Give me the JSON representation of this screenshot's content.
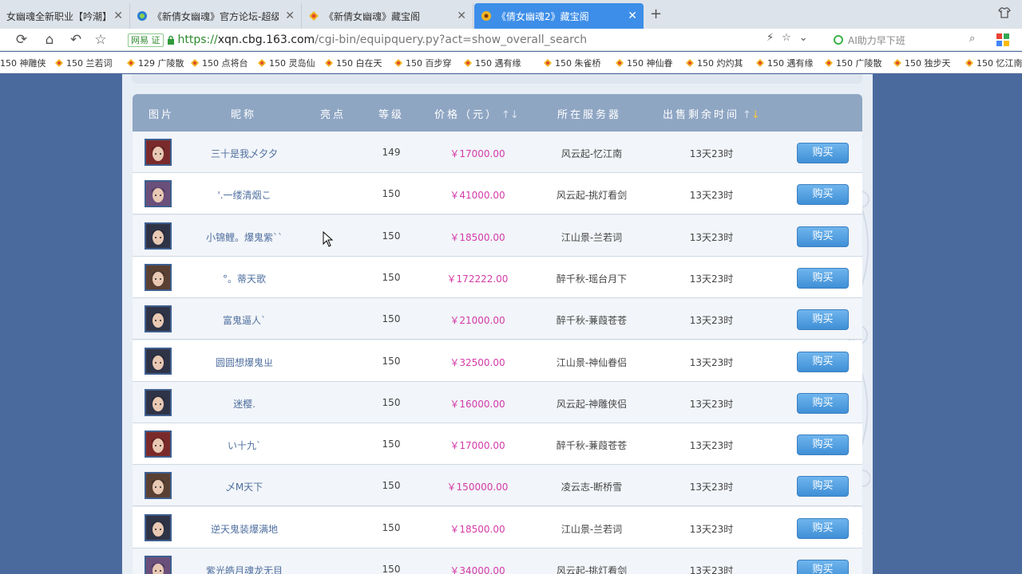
{
  "browser": {
    "tabs": [
      {
        "title": "女幽魂全新职业【吟潮】上",
        "active": false
      },
      {
        "title": "《新倩女幽魂》官方论坛-超级&",
        "active": false
      },
      {
        "title": "《新倩女幽魂》藏宝阁",
        "active": false
      },
      {
        "title": "《倩女幽魂2》藏宝阁",
        "active": true
      }
    ],
    "new_tab": "+",
    "site_badge": "网易",
    "site_badge_tag": "证",
    "url_proto": "https://",
    "url_host": "xqn.cbg.163.com",
    "url_path": "/cgi-bin/equipquery.py?act=show_overall_search",
    "ai_search_placeholder": "AI助力早下班",
    "bookmarks": [
      "150 神雕侠",
      "150 兰若词",
      "129 广陵散",
      "150 点将台",
      "150 灵岛仙",
      "150 白在天",
      "150 百步穿",
      "150 遇有缘",
      "150 朱雀桥",
      "150 神仙眷",
      "150 灼灼其",
      "150 遇有缘",
      "150 广陵散",
      "150 独步天",
      "150 忆江南"
    ]
  },
  "table": {
    "headers": {
      "image": "图片",
      "nickname": "昵称",
      "highlight": "亮点",
      "level": "等级",
      "price": "价格（元）",
      "server": "所在服务器",
      "remaining": "出售剩余时间"
    },
    "sort_up": "↑",
    "sort_down": "↓",
    "buy_label": "购买",
    "rows": [
      {
        "nickname": "三十是我乄夕夕",
        "level": "149",
        "price": "￥17000.00",
        "server": "风云起-忆江南",
        "remaining": "13天23时",
        "avatar_color": "#7a2a2a"
      },
      {
        "nickname": "'.一缕清烟こ",
        "level": "150",
        "price": "￥41000.00",
        "server": "风云起-挑灯看剑",
        "remaining": "13天23时",
        "avatar_color": "#6a4f7a"
      },
      {
        "nickname": "小锦鲤。爆鬼紫``",
        "level": "150",
        "price": "￥18500.00",
        "server": "江山景-兰若词",
        "remaining": "13天23时",
        "avatar_color": "#2f3346"
      },
      {
        "nickname": "°。蒂天歌",
        "level": "150",
        "price": "￥172222.00",
        "server": "醉千秋-瑶台月下",
        "remaining": "13天23时",
        "avatar_color": "#5a4032"
      },
      {
        "nickname": "富鬼逼人`",
        "level": "150",
        "price": "￥21000.00",
        "server": "醉千秋-蒹葭苍苍",
        "remaining": "13天23时",
        "avatar_color": "#2f3346"
      },
      {
        "nickname": "圆圆想爆鬼ㄓ",
        "level": "150",
        "price": "￥32500.00",
        "server": "江山景-神仙眷侣",
        "remaining": "13天23时",
        "avatar_color": "#2f3346"
      },
      {
        "nickname": "迷樱.",
        "level": "150",
        "price": "￥16000.00",
        "server": "风云起-神雕侠侣",
        "remaining": "13天23时",
        "avatar_color": "#2f3346"
      },
      {
        "nickname": "い十九`",
        "level": "150",
        "price": "￥17000.00",
        "server": "醉千秋-蒹葭苍苍",
        "remaining": "13天23时",
        "avatar_color": "#7a2a2a"
      },
      {
        "nickname": "乄M天下",
        "level": "150",
        "price": "￥150000.00",
        "server": "凌云志-断桥雪",
        "remaining": "13天23时",
        "avatar_color": "#5a4032"
      },
      {
        "nickname": "逆天鬼装爆满地",
        "level": "150",
        "price": "￥18500.00",
        "server": "江山景-兰若词",
        "remaining": "13天23时",
        "avatar_color": "#2f3346"
      },
      {
        "nickname": "紫光皓月魂龙无目",
        "level": "150",
        "price": "￥34000.00",
        "server": "风云起-挑灯看剑",
        "remaining": "13天23时",
        "avatar_color": "#6a4f7a"
      }
    ]
  }
}
